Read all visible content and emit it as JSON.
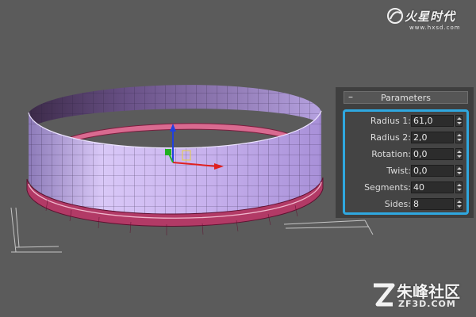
{
  "panel": {
    "rollout_title": "Parameters",
    "collapse_symbol": "–",
    "accent_color": "#2fa8e0",
    "params": [
      {
        "label": "Radius 1:",
        "value": "61,0"
      },
      {
        "label": "Radius 2:",
        "value": "2,0"
      },
      {
        "label": "Rotation:",
        "value": "0,0"
      },
      {
        "label": "Twist:",
        "value": "0,0"
      },
      {
        "label": "Segments:",
        "value": "40"
      },
      {
        "label": "Sides:",
        "value": "8"
      }
    ]
  },
  "watermarks": {
    "top_title": "火星时代",
    "top_url": "www.hxsd.com",
    "bottom_cn": "朱峰社区",
    "bottom_en": "ZF3D.COM"
  },
  "colors": {
    "viewport_bg": "#5b5b5b",
    "wall_color": "#c8b4f0",
    "ring_color": "#b03060",
    "axis_x": "#e02020",
    "axis_y": "#20b020",
    "axis_z": "#2040e0"
  },
  "icons": [
    "gizmo-transform-icon",
    "collapse-minus-icon",
    "spinner-icon",
    "watermark-logo-icon",
    "watermark-z-icon"
  ]
}
